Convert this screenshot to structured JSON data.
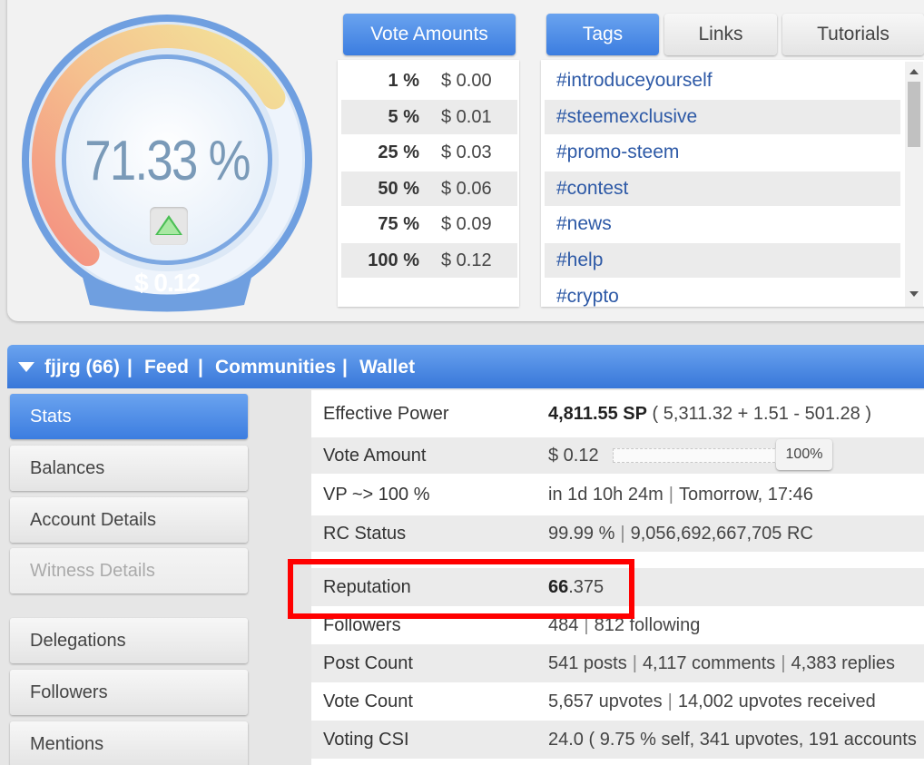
{
  "gauge": {
    "percent": "71.33 %",
    "value": "$ 0.12",
    "fill_fraction": 0.7133,
    "up_arrow_icon": "triangle-up-icon"
  },
  "vote_amounts": {
    "header": "Vote Amounts",
    "rows": [
      {
        "pct": "1 %",
        "amount": "$ 0.00"
      },
      {
        "pct": "5 %",
        "amount": "$ 0.01"
      },
      {
        "pct": "25 %",
        "amount": "$ 0.03"
      },
      {
        "pct": "50 %",
        "amount": "$ 0.06"
      },
      {
        "pct": "75 %",
        "amount": "$ 0.09"
      },
      {
        "pct": "100 %",
        "amount": "$ 0.12"
      }
    ]
  },
  "tabs": {
    "tags": "Tags",
    "links": "Links",
    "tutorials": "Tutorials"
  },
  "tags": [
    "#introduceyourself",
    "#steemexclusive",
    "#promo-steem",
    "#contest",
    "#news",
    "#help",
    "#crypto"
  ],
  "account_bar": {
    "account": "fjjrg (66)",
    "feed": "Feed",
    "communities": "Communities",
    "wallet": "Wallet",
    "separator": "|"
  },
  "side_menu": {
    "stats": "Stats",
    "balances": "Balances",
    "account_details": "Account Details",
    "witness_details": "Witness Details",
    "delegations": "Delegations",
    "followers": "Followers",
    "mentions": "Mentions"
  },
  "stats": {
    "effective_power": {
      "label": "Effective Power",
      "value_bold": "4,811.55 SP",
      "value_rest": " ( 5,311.32 + 1.51 - 501.28 )"
    },
    "vote_amount": {
      "label": "Vote Amount",
      "value": "$ 0.12",
      "slider_label": "100%",
      "slider_fraction": 1.0
    },
    "vp": {
      "label": "VP ~> 100 %",
      "part1": "in 1d 10h 24m",
      "part2": "Tomorrow, 17:46"
    },
    "rc_status": {
      "label": "RC Status",
      "part1": "99.99 %",
      "part2": "9,056,692,667,705 RC"
    },
    "reputation": {
      "label": "Reputation",
      "value_bold": "66",
      "value_rest": ".375"
    },
    "followers": {
      "label": "Followers",
      "part1": "484",
      "part2": "812 following"
    },
    "post_count": {
      "label": "Post Count",
      "part1": "541 posts",
      "part2": "4,117 comments",
      "part3": "4,383 replies"
    },
    "vote_count": {
      "label": "Vote Count",
      "part1": "5,657 upvotes",
      "part2": "14,002 upvotes received"
    },
    "voting_csi": {
      "label": "Voting CSI",
      "value": "24.0 ( 9.75 % self, 341 upvotes, 191 accounts"
    }
  },
  "colors": {
    "accent_blue": "#4a8be6",
    "tag_link": "#2d59a6",
    "highlight": "#ff0000",
    "gauge_red": "#f39a86",
    "gauge_yellow": "#f3e3a0"
  }
}
